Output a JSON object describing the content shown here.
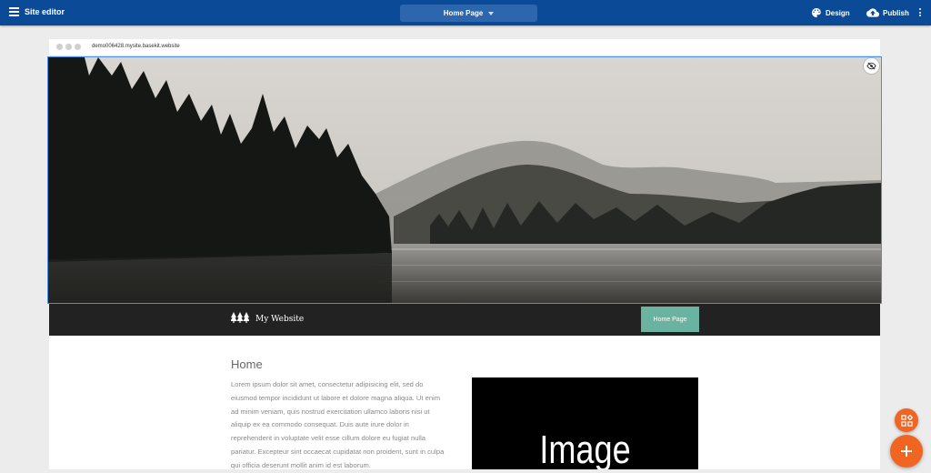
{
  "app": {
    "title": "Site editor"
  },
  "toolbar": {
    "page_selector": "Home Page",
    "design_label": "Design",
    "publish_label": "Publish"
  },
  "browser": {
    "url": "demo006428.mysite.basekit.website"
  },
  "site": {
    "name": "My Website",
    "nav": [
      {
        "label": "Home Page"
      }
    ]
  },
  "content": {
    "title": "Home",
    "body": "Lorem ipsum dolor sit amet, consectetur adipisicing elit, sed do eiusmod tempor incididunt ut labore et dolore magna aliqua. Ut enim ad minim veniam, quis nostrud exercitation ullamco laboris nisi ut aliquip ex ea commodo consequat. Duis aute irure dolor in reprehenderit in voluptate velit esse cillum dolore eu fugiat nulla pariatur. Excepteur sint occaecat cupidatat non proident, sunt in culpa qui officia deserunt mollit anim id est laborum.",
    "image_placeholder": "Image"
  },
  "icons": {
    "menu": "hamburger-icon",
    "design": "palette-icon",
    "publish": "cloud-upload-icon",
    "more": "more-vertical-icon",
    "hide": "eye-off-icon",
    "logo": "pine-trees-icon",
    "widgets": "add-widget-icon",
    "add": "plus-icon"
  },
  "colors": {
    "topbar": "#0b4a96",
    "page_selector": "#2d66ad",
    "site_header": "#222222",
    "nav_active": "#6ab3a1",
    "fab": "#f06522",
    "selection": "#4a90e2"
  }
}
